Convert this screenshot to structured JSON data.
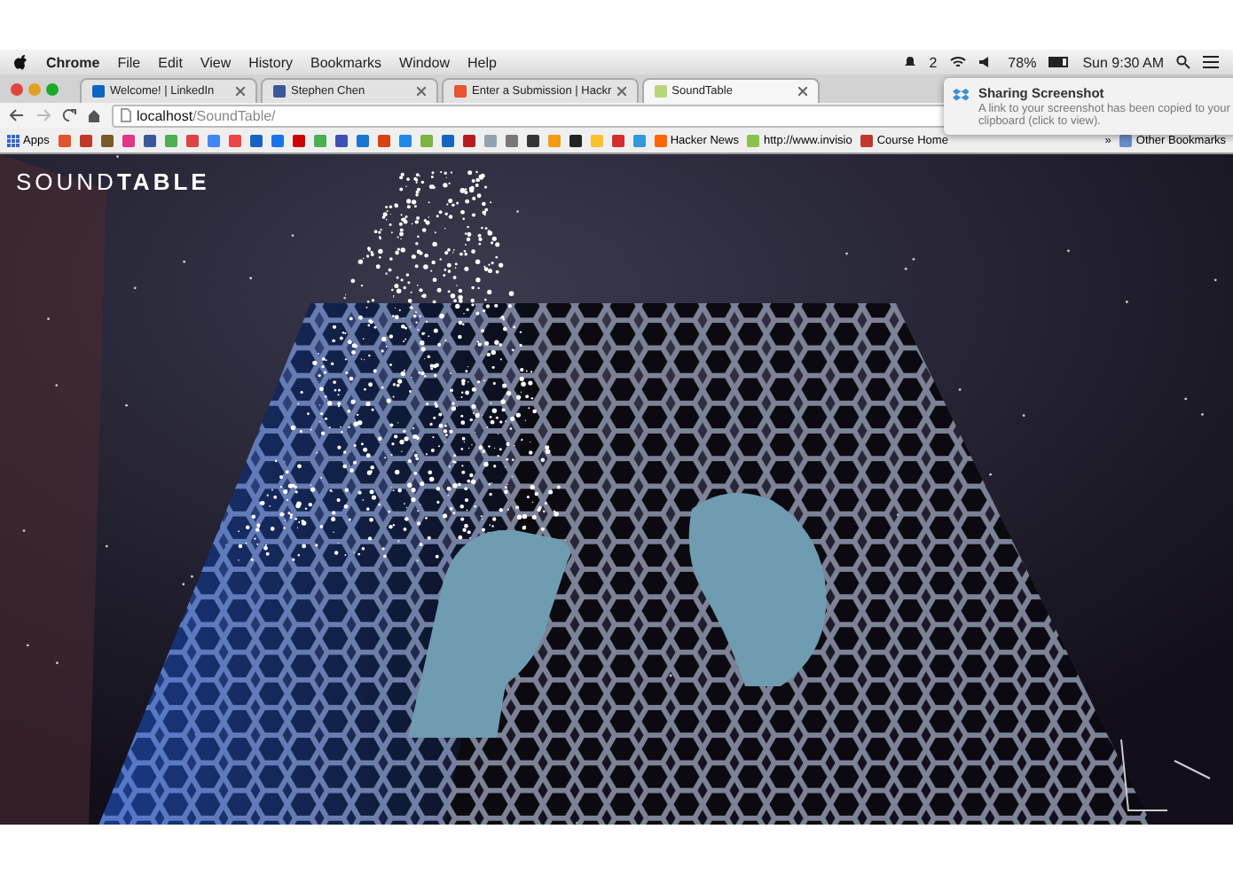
{
  "menubar": {
    "app": "Chrome",
    "menus": [
      "File",
      "Edit",
      "View",
      "History",
      "Bookmarks",
      "Window",
      "Help"
    ],
    "badge": "2",
    "battery": "78%",
    "clock": "Sun 9:30 AM"
  },
  "tabs": [
    {
      "title": "Welcome! | LinkedIn",
      "selected": false
    },
    {
      "title": "Stephen Chen",
      "selected": false
    },
    {
      "title": "Enter a Submission | Hackr",
      "selected": false
    },
    {
      "title": "SoundTable",
      "selected": true
    }
  ],
  "address": {
    "host": "localhost",
    "path": "/SoundTable/"
  },
  "bookmarks": {
    "apps": "Apps",
    "items": [
      "Hacker News",
      "http://www.invisio",
      "Course Home"
    ],
    "more": "»",
    "other": "Other Bookmarks"
  },
  "notification": {
    "title": "Sharing Screenshot",
    "body": "A link to your screenshot has been copied to your clipboard (click to view)."
  },
  "logo": {
    "first": "SOUND",
    "second": "TABLE"
  }
}
